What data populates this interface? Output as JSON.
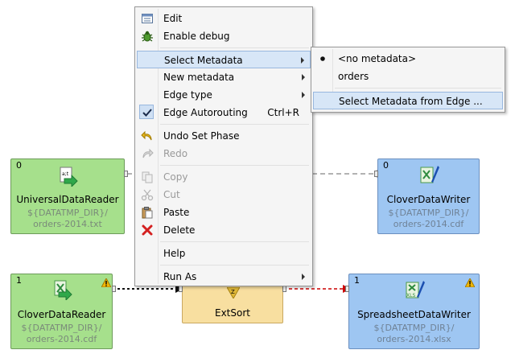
{
  "menu": {
    "items": [
      {
        "label": "Edit",
        "icon": "edit-icon",
        "enabled": true
      },
      {
        "label": "Enable debug",
        "icon": "bug-icon",
        "enabled": true
      },
      {
        "label": "Select Metadata",
        "submenu": true,
        "highlighted": true
      },
      {
        "label": "New metadata",
        "submenu": true
      },
      {
        "label": "Edge type",
        "submenu": true
      },
      {
        "label": "Edge Autorouting",
        "shortcut": "Ctrl+R",
        "checked": true
      },
      {
        "label": "Undo Set Phase",
        "icon": "undo-icon",
        "enabled": true
      },
      {
        "label": "Redo",
        "icon": "redo-icon",
        "enabled": false
      },
      {
        "label": "Copy",
        "icon": "copy-icon",
        "enabled": false
      },
      {
        "label": "Cut",
        "icon": "cut-icon",
        "enabled": false
      },
      {
        "label": "Paste",
        "icon": "paste-icon",
        "enabled": true
      },
      {
        "label": "Delete",
        "icon": "delete-icon",
        "enabled": true
      },
      {
        "label": "Help"
      },
      {
        "label": "Run As",
        "submenu": true
      }
    ]
  },
  "submenu": {
    "items": [
      {
        "label": "<no metadata>",
        "selected": true
      },
      {
        "label": "orders"
      },
      {
        "label": "Select Metadata from Edge ...",
        "highlighted": true
      }
    ]
  },
  "nodes": {
    "universal_reader": {
      "phase": "0",
      "name": "UniversalDataReader",
      "path1": "${DATATMP_DIR}/",
      "path2": "orders-2014.txt"
    },
    "clover_writer": {
      "phase": "0",
      "name": "CloverDataWriter",
      "path1": "${DATATMP_DIR}/",
      "path2": "orders-2014.cdf"
    },
    "clover_reader": {
      "phase": "1",
      "name": "CloverDataReader",
      "path1": "${DATATMP_DIR}/",
      "path2": "orders-2014.cdf"
    },
    "ext_sort": {
      "name": "ExtSort"
    },
    "spreadsheet_writer": {
      "phase": "1",
      "name": "SpreadsheetDataWriter",
      "path1": "${DATATMP_DIR}/",
      "path2": "orders-2014.xlsx"
    }
  },
  "colors": {
    "reader_node": "#a6e08c",
    "writer_node": "#9ec6f2",
    "transformer_node": "#f8dfa0",
    "menu_highlight": "#d7e6f7",
    "edge_error": "#cc0000"
  }
}
